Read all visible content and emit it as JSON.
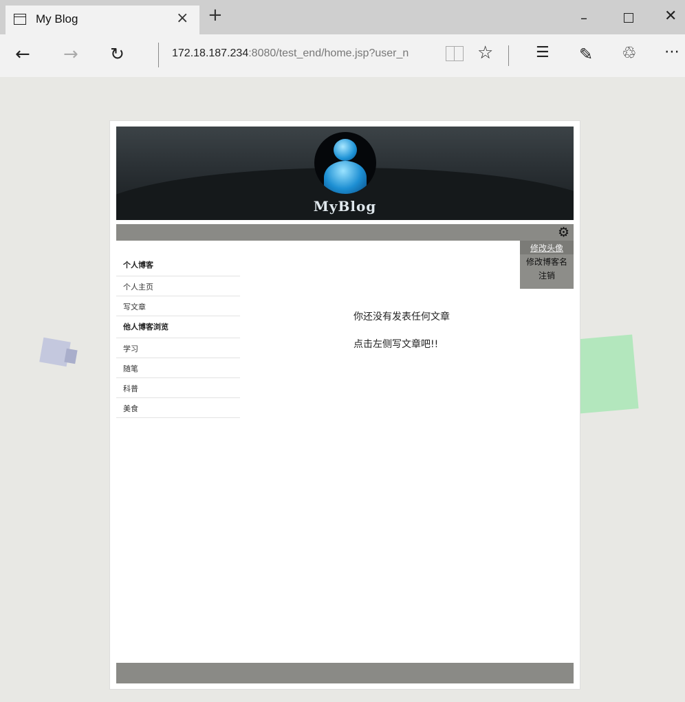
{
  "browser": {
    "tab_title": "My Blog",
    "tab_close_glyph": "×",
    "new_tab_glyph": "+",
    "url_host": "172.18.187.234",
    "url_path": ":8080/test_end/home.jsp?user_n",
    "icons": [
      "tab-page-icon",
      "back-arrow-icon",
      "forward-arrow-icon",
      "refresh-icon",
      "reading-view-icon",
      "favorite-star-icon",
      "hub-icon",
      "web-note-icon",
      "share-icon",
      "more-icon"
    ]
  },
  "blog": {
    "title": "MyBlog",
    "user_menu": [
      {
        "label": "修改头像"
      },
      {
        "label": "修改博客名"
      },
      {
        "label": "注销"
      }
    ],
    "sidebar": {
      "personal_heading": "个人博客",
      "personal_items": [
        {
          "label": "个人主页"
        },
        {
          "label": "写文章"
        }
      ],
      "browse_heading": "他人博客浏览",
      "browse_items": [
        {
          "label": "学习"
        },
        {
          "label": "随笔"
        },
        {
          "label": "科普"
        },
        {
          "label": "美食"
        }
      ]
    },
    "empty_message": "你还没有发表任何文章",
    "empty_tip": "点击左侧写文章吧!!"
  },
  "colors": {
    "banner_top": "#3c4347",
    "banner_bottom": "#181c1f",
    "toolbar": "#8a8a86",
    "page_bg": "#e8e8e4"
  }
}
